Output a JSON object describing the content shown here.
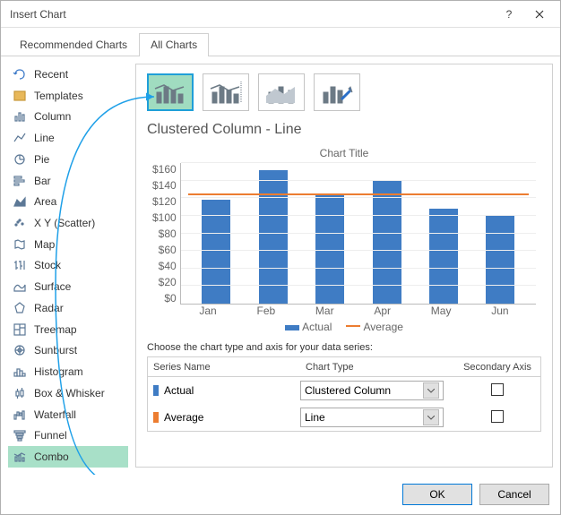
{
  "window": {
    "title": "Insert Chart"
  },
  "tabs": {
    "recommended": "Recommended Charts",
    "all": "All Charts"
  },
  "sidebar": {
    "items": [
      {
        "label": "Recent"
      },
      {
        "label": "Templates"
      },
      {
        "label": "Column"
      },
      {
        "label": "Line"
      },
      {
        "label": "Pie"
      },
      {
        "label": "Bar"
      },
      {
        "label": "Area"
      },
      {
        "label": "X Y (Scatter)"
      },
      {
        "label": "Map"
      },
      {
        "label": "Stock"
      },
      {
        "label": "Surface"
      },
      {
        "label": "Radar"
      },
      {
        "label": "Treemap"
      },
      {
        "label": "Sunburst"
      },
      {
        "label": "Histogram"
      },
      {
        "label": "Box & Whisker"
      },
      {
        "label": "Waterfall"
      },
      {
        "label": "Funnel"
      },
      {
        "label": "Combo"
      }
    ]
  },
  "main": {
    "subtitle": "Clustered Column - Line",
    "chart_title": "Chart Title",
    "series_label": "Choose the chart type and axis for your data series:",
    "headers": {
      "name": "Series Name",
      "type": "Chart Type",
      "axis": "Secondary Axis"
    },
    "series": [
      {
        "name": "Actual",
        "type": "Clustered Column",
        "color": "#3f7cc4"
      },
      {
        "name": "Average",
        "type": "Line",
        "color": "#ec7d31"
      }
    ]
  },
  "chart_data": {
    "type": "combo",
    "title": "Chart Title",
    "categories": [
      "Jan",
      "Feb",
      "Mar",
      "Apr",
      "May",
      "Jun"
    ],
    "series": [
      {
        "name": "Actual",
        "type": "bar",
        "values": [
          118,
          152,
          124,
          140,
          108,
          100
        ],
        "color": "#3f7cc4"
      },
      {
        "name": "Average",
        "type": "line",
        "values": [
          123,
          123,
          123,
          123,
          123,
          123
        ],
        "color": "#ec7d31"
      }
    ],
    "ylabel": "",
    "xlabel": "",
    "ylim": [
      0,
      160
    ],
    "yticks": [
      "$0",
      "$20",
      "$40",
      "$60",
      "$80",
      "$100",
      "$120",
      "$140",
      "$160"
    ]
  },
  "buttons": {
    "ok": "OK",
    "cancel": "Cancel"
  }
}
